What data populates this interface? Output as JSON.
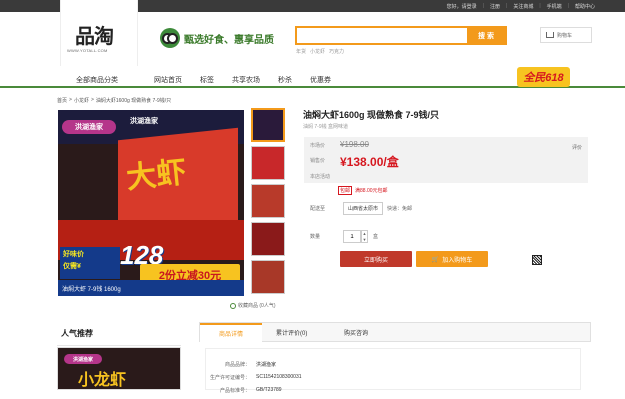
{
  "topbar": {
    "links": [
      "您好，请登录",
      "注册",
      "关注商城",
      "手机端",
      "帮助中心"
    ]
  },
  "logo": {
    "mark": "品淘",
    "url": "WWW.YOTALL.COM"
  },
  "slogan": "甄选好食、惠享品质",
  "search": {
    "placeholder": "",
    "button": "搜 索",
    "hot": [
      "年货",
      "小龙虾",
      "巧克力"
    ]
  },
  "cart": {
    "label": "购物车"
  },
  "nav": {
    "category": "全部商品分类",
    "items": [
      "网站首页",
      "标签",
      "共享农场",
      "秒杀",
      "优惠券"
    ]
  },
  "promo": "全民618",
  "breadcrumb": [
    "首页",
    ">",
    "小龙虾",
    ">",
    "油焖大虾1600g 现做熟食 7-9钱/只"
  ],
  "product": {
    "title": "油焖大虾1600g 现做熟食 7-9钱/只",
    "subtitle": "油焖 7-9钱 盒网味道",
    "market_label": "市场价",
    "market_price": "¥198.00",
    "sale_label": "销售价",
    "sale_price": "¥138.00/盒",
    "activity_label": "本店活动",
    "reviews": "评价",
    "coupon_tag": "包邮",
    "coupon_text": "满88.00元包邮",
    "ship_label": "配送至",
    "ship_to": "山西省太原市",
    "ship_note": "快递：免邮",
    "qty_label": "数量",
    "qty_value": "1",
    "qty_unit": "盒",
    "buy": "立即购买",
    "add_cart": "加入购物车",
    "fav": "收藏商品 (0人气)"
  },
  "image": {
    "badge": "洪湖渔家",
    "char": "大虾",
    "price_l1": "好味价",
    "price_l2": "仅需¥",
    "price": "128",
    "cut": "2份立减30元",
    "sub": "油焖大虾 7-9钱 1600g"
  },
  "sidebar": {
    "title": "人气推荐",
    "badge": "洪湖渔家",
    "char": "小龙虾"
  },
  "tabs": [
    "商品详情",
    "累计评价(0)",
    "购买咨询"
  ],
  "details": [
    {
      "k": "商品品牌：",
      "v": "洪湖渔家"
    },
    {
      "k": "生产许可证编号：",
      "v": "SC11542108300031"
    },
    {
      "k": "产品标准号：",
      "v": "GB/T23789"
    }
  ]
}
